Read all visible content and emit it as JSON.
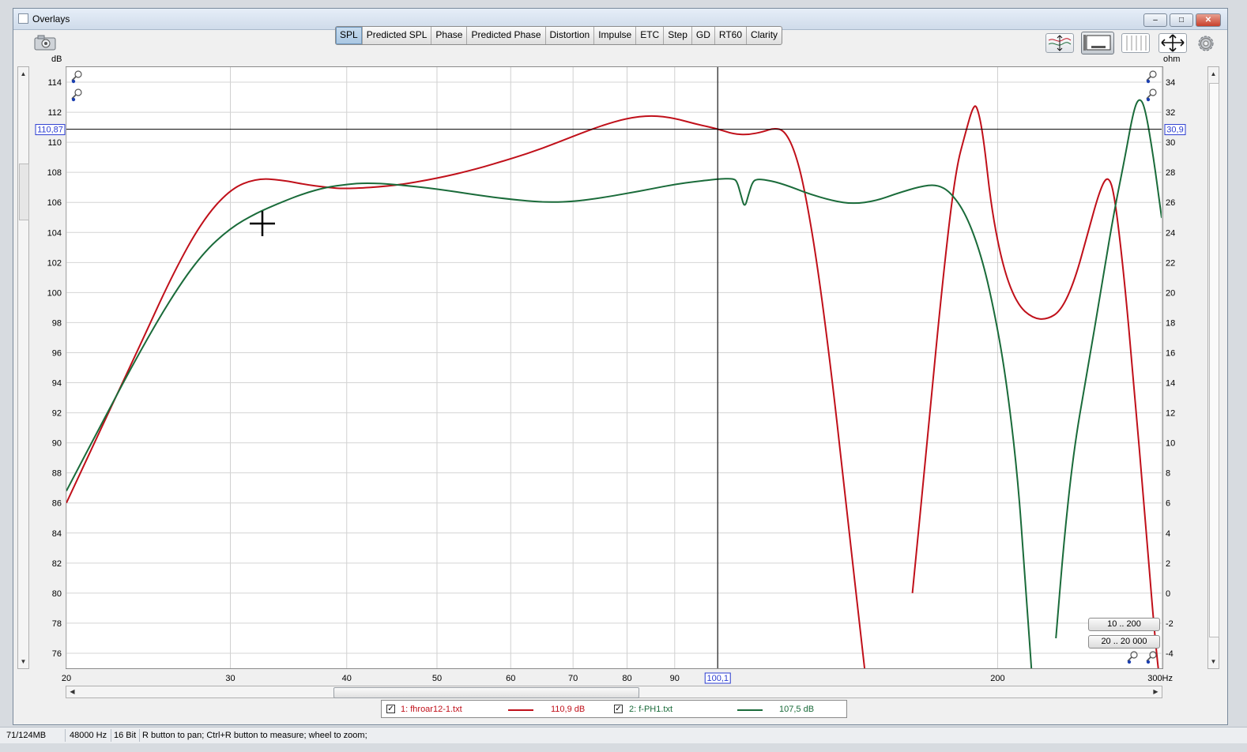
{
  "window": {
    "title": "Overlays",
    "minimize": "–",
    "maximize": "□",
    "close": "✕"
  },
  "tabs": [
    {
      "label": "SPL",
      "active": true
    },
    {
      "label": "Predicted SPL",
      "active": false
    },
    {
      "label": "Phase",
      "active": false
    },
    {
      "label": "Predicted Phase",
      "active": false
    },
    {
      "label": "Distortion",
      "active": false
    },
    {
      "label": "Impulse",
      "active": false
    },
    {
      "label": "ETC",
      "active": false
    },
    {
      "label": "Step",
      "active": false
    },
    {
      "label": "GD",
      "active": false
    },
    {
      "label": "RT60",
      "active": false
    },
    {
      "label": "Clarity",
      "active": false
    }
  ],
  "icons": {
    "camera": "camera-icon",
    "trace_arrange": "trace-arrange-icon",
    "graph_layout": "graph-layout-icon",
    "compare": "compare-icon",
    "fit": "fit-arrows-icon",
    "settings": "gear-icon",
    "zoom": "magnifier-icon"
  },
  "range_buttons": [
    "10 .. 200",
    "20 .. 20 000"
  ],
  "chart_data": {
    "type": "line",
    "xlabel": "Hz",
    "left_axis_label": "dB",
    "right_axis_label": "ohm",
    "x_scale": "log",
    "xlim": [
      20,
      300
    ],
    "ylim": [
      75,
      115
    ],
    "right_ylim": [
      -5,
      35
    ],
    "x_ticks": [
      20,
      30,
      40,
      50,
      60,
      70,
      80,
      90,
      100,
      200,
      300
    ],
    "x_tick_labels": [
      "20",
      "30",
      "40",
      "50",
      "60",
      "70",
      "80",
      "90",
      "",
      "200",
      "300Hz"
    ],
    "y_ticks": [
      76,
      78,
      80,
      82,
      84,
      86,
      88,
      90,
      92,
      94,
      96,
      98,
      100,
      102,
      104,
      106,
      108,
      110,
      112,
      114
    ],
    "right_y_ticks": [
      -4,
      -2,
      0,
      2,
      4,
      6,
      8,
      10,
      12,
      14,
      16,
      18,
      20,
      22,
      24,
      26,
      28,
      30,
      32,
      34
    ],
    "grid": true,
    "cursor": {
      "x_readout": "100,1",
      "y_readout": "110,87",
      "right_readout": "30,9",
      "x": 100.1,
      "y": 110.87
    },
    "series": [
      {
        "name": "1: fhroar12-1.txt",
        "readout": "110,9 dB",
        "color": "#c0101a",
        "points": [
          [
            20,
            86.0
          ],
          [
            22,
            91.5
          ],
          [
            24,
            96.5
          ],
          [
            26,
            101.2
          ],
          [
            28,
            104.8
          ],
          [
            30,
            106.9
          ],
          [
            32,
            107.6
          ],
          [
            34,
            107.5
          ],
          [
            36,
            107.2
          ],
          [
            38,
            107.0
          ],
          [
            40,
            106.9
          ],
          [
            45,
            107.1
          ],
          [
            50,
            107.6
          ],
          [
            55,
            108.2
          ],
          [
            60,
            108.9
          ],
          [
            65,
            109.6
          ],
          [
            70,
            110.4
          ],
          [
            75,
            111.1
          ],
          [
            80,
            111.6
          ],
          [
            85,
            111.8
          ],
          [
            90,
            111.6
          ],
          [
            95,
            111.2
          ],
          [
            100,
            110.9
          ],
          [
            104,
            110.55
          ],
          [
            108,
            110.5
          ],
          [
            112,
            110.7
          ],
          [
            115,
            110.95
          ],
          [
            118,
            110.8
          ],
          [
            121,
            109.5
          ],
          [
            124,
            107.0
          ],
          [
            128,
            102.0
          ],
          [
            133,
            94.0
          ],
          [
            138,
            85.0
          ],
          [
            143,
            76.5
          ],
          [
            147,
            70.0
          ],
          [
            156,
            70.0
          ],
          [
            162,
            80.0
          ],
          [
            168,
            90.0
          ],
          [
            174,
            100.0
          ],
          [
            180,
            108.0
          ],
          [
            185,
            110.8
          ],
          [
            188,
            112.3
          ],
          [
            190,
            112.5
          ],
          [
            193,
            110.5
          ],
          [
            197,
            105.5
          ],
          [
            203,
            101.5
          ],
          [
            210,
            99.2
          ],
          [
            218,
            98.3
          ],
          [
            226,
            98.2
          ],
          [
            234,
            98.8
          ],
          [
            242,
            100.8
          ],
          [
            250,
            104.0
          ],
          [
            258,
            107.0
          ],
          [
            263,
            107.8
          ],
          [
            267,
            106.5
          ],
          [
            273,
            101.5
          ],
          [
            280,
            94.0
          ],
          [
            288,
            85.0
          ],
          [
            295,
            77.0
          ],
          [
            300,
            73.0
          ]
        ]
      },
      {
        "name": "2: f-PH1.txt",
        "readout": "107,5 dB",
        "color": "#1a6b3a",
        "points": [
          [
            20,
            86.8
          ],
          [
            22,
            91.7
          ],
          [
            24,
            96.1
          ],
          [
            26,
            99.8
          ],
          [
            28,
            102.6
          ],
          [
            30,
            104.3
          ],
          [
            32,
            105.3
          ],
          [
            34,
            106.0
          ],
          [
            36,
            106.6
          ],
          [
            38,
            107.0
          ],
          [
            40,
            107.2
          ],
          [
            42,
            107.3
          ],
          [
            45,
            107.2
          ],
          [
            50,
            106.9
          ],
          [
            55,
            106.5
          ],
          [
            60,
            106.2
          ],
          [
            65,
            106.0
          ],
          [
            70,
            106.05
          ],
          [
            75,
            106.3
          ],
          [
            80,
            106.6
          ],
          [
            85,
            106.9
          ],
          [
            90,
            107.2
          ],
          [
            95,
            107.4
          ],
          [
            100,
            107.55
          ],
          [
            104,
            107.6
          ],
          [
            105,
            107.4
          ],
          [
            106,
            106.5
          ],
          [
            107,
            105.6
          ],
          [
            108,
            106.5
          ],
          [
            109,
            107.3
          ],
          [
            110,
            107.55
          ],
          [
            113,
            107.5
          ],
          [
            118,
            107.2
          ],
          [
            125,
            106.6
          ],
          [
            133,
            106.1
          ],
          [
            140,
            105.9
          ],
          [
            148,
            106.1
          ],
          [
            156,
            106.6
          ],
          [
            165,
            107.05
          ],
          [
            172,
            107.2
          ],
          [
            178,
            106.7
          ],
          [
            185,
            105.2
          ],
          [
            192,
            102.5
          ],
          [
            198,
            99.0
          ],
          [
            204,
            94.5
          ],
          [
            210,
            88.0
          ],
          [
            214,
            81.0
          ],
          [
            218,
            74.0
          ],
          [
            220,
            70.0
          ],
          [
            228,
            70.0
          ],
          [
            231,
            77.0
          ],
          [
            236,
            84.0
          ],
          [
            242,
            90.0
          ],
          [
            250,
            95.0
          ],
          [
            258,
            100.0
          ],
          [
            266,
            105.0
          ],
          [
            274,
            109.0
          ],
          [
            280,
            112.2
          ],
          [
            284,
            113.0
          ],
          [
            288,
            112.3
          ],
          [
            294,
            109.0
          ],
          [
            300,
            105.0
          ]
        ]
      }
    ]
  },
  "legend": [
    {
      "checked": true,
      "name": "1: fhroar12-1.txt",
      "value": "110,9 dB",
      "color": "#c0101a"
    },
    {
      "checked": true,
      "name": "2: f-PH1.txt",
      "value": "107,5 dB",
      "color": "#1a6b3a"
    }
  ],
  "status": {
    "memory": "71/124MB",
    "sample_rate": "48000 Hz",
    "bits": "16 Bit",
    "hint": "R button to pan; Ctrl+R button to measure; wheel to zoom;"
  }
}
